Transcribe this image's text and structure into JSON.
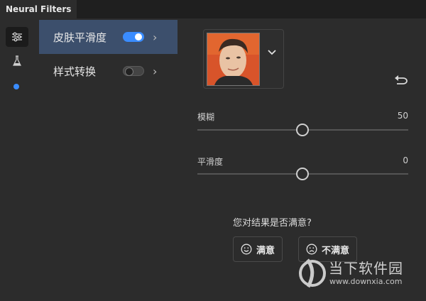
{
  "window": {
    "title": "Neural Filters"
  },
  "rail": {
    "items": [
      {
        "icon": "sliders-icon",
        "active": true
      },
      {
        "icon": "flask-icon",
        "active": false
      }
    ],
    "dot_color": "#3a8cff"
  },
  "filters": [
    {
      "label": "皮肤平滑度",
      "enabled": true,
      "selected": true
    },
    {
      "label": "样式转换",
      "enabled": false,
      "selected": false
    }
  ],
  "preview": {
    "icon": "portrait-thumbnail",
    "dropdown_icon": "chevron-down-icon",
    "reset_icon": "undo-icon"
  },
  "sliders": [
    {
      "label": "模糊",
      "value": "50",
      "fraction": 0.5
    },
    {
      "label": "平滑度",
      "value": "0",
      "fraction": 0.5
    }
  ],
  "feedback": {
    "question": "您对结果是否满意?",
    "satisfied": "满意",
    "unsatisfied": "不满意"
  },
  "watermark": {
    "name": "当下软件园",
    "url": "www.downxia.com"
  },
  "colors": {
    "accent": "#3a8cff",
    "selected_row": "#3c4f6c",
    "background": "#2c2c2c"
  }
}
